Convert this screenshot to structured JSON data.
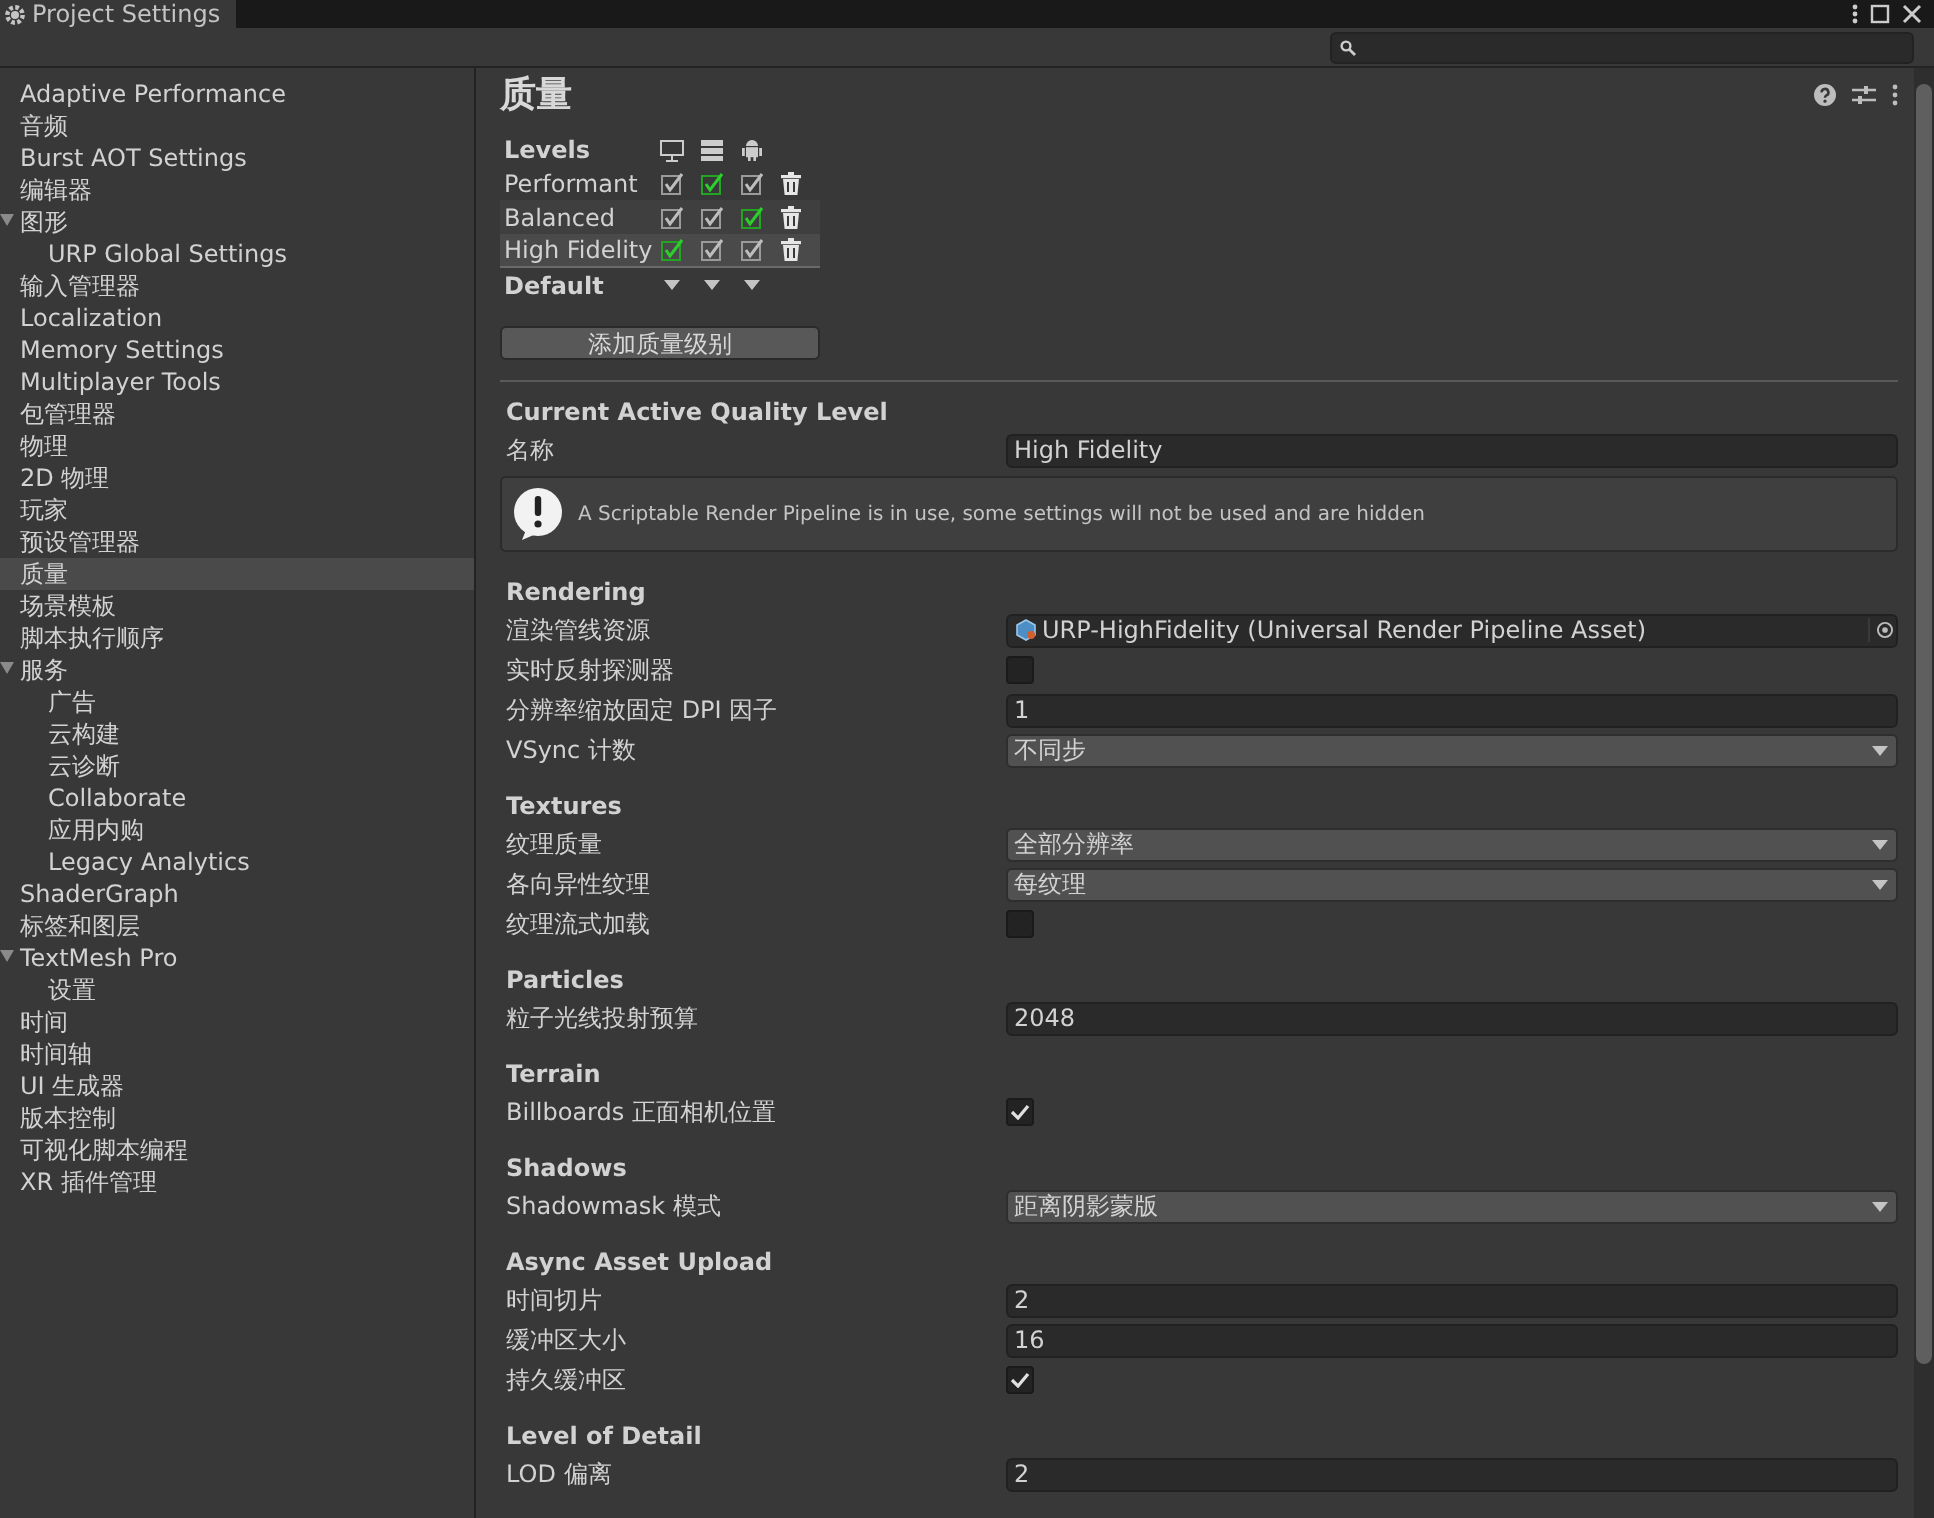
{
  "window": {
    "title": "Project Settings"
  },
  "sidebar": {
    "items": [
      {
        "label": "Adaptive Performance",
        "selected": false
      },
      {
        "label": "音频",
        "selected": false
      },
      {
        "label": "Burst AOT Settings",
        "selected": false
      },
      {
        "label": "编辑器",
        "selected": false
      },
      {
        "label": "图形",
        "selected": false,
        "expanded": true,
        "children": [
          {
            "label": "URP Global Settings",
            "selected": false
          }
        ]
      },
      {
        "label": "输入管理器",
        "selected": false
      },
      {
        "label": "Localization",
        "selected": false
      },
      {
        "label": "Memory Settings",
        "selected": false
      },
      {
        "label": "Multiplayer Tools",
        "selected": false
      },
      {
        "label": "包管理器",
        "selected": false
      },
      {
        "label": "物理",
        "selected": false
      },
      {
        "label": "2D 物理",
        "selected": false
      },
      {
        "label": "玩家",
        "selected": false
      },
      {
        "label": "预设管理器",
        "selected": false
      },
      {
        "label": "质量",
        "selected": true
      },
      {
        "label": "场景模板",
        "selected": false
      },
      {
        "label": "脚本执行顺序",
        "selected": false
      },
      {
        "label": "服务",
        "selected": false,
        "expanded": true,
        "children": [
          {
            "label": "广告",
            "selected": false
          },
          {
            "label": "云构建",
            "selected": false
          },
          {
            "label": "云诊断",
            "selected": false
          },
          {
            "label": "Collaborate",
            "selected": false
          },
          {
            "label": "应用内购",
            "selected": false
          },
          {
            "label": "Legacy Analytics",
            "selected": false
          }
        ]
      },
      {
        "label": "ShaderGraph",
        "selected": false
      },
      {
        "label": "标签和图层",
        "selected": false
      },
      {
        "label": "TextMesh Pro",
        "selected": false,
        "expanded": true,
        "children": [
          {
            "label": "设置",
            "selected": false
          }
        ]
      },
      {
        "label": "时间",
        "selected": false
      },
      {
        "label": "时间轴",
        "selected": false
      },
      {
        "label": "UI 生成器",
        "selected": false
      },
      {
        "label": "版本控制",
        "selected": false
      },
      {
        "label": "可视化脚本编程",
        "selected": false
      },
      {
        "label": "XR 插件管理",
        "selected": false
      }
    ]
  },
  "page": {
    "title": "质量",
    "levels": {
      "label": "Levels",
      "default_label": "Default",
      "add_button": "添加质量级别",
      "rows": [
        {
          "name": "Performant",
          "selected": false,
          "platforms": [
            {
              "checked": true,
              "default": false
            },
            {
              "checked": true,
              "default": true
            },
            {
              "checked": true,
              "default": false
            }
          ]
        },
        {
          "name": "Balanced",
          "selected": false,
          "platforms": [
            {
              "checked": true,
              "default": false
            },
            {
              "checked": true,
              "default": false
            },
            {
              "checked": true,
              "default": true
            }
          ]
        },
        {
          "name": "High Fidelity",
          "selected": true,
          "platforms": [
            {
              "checked": true,
              "default": true
            },
            {
              "checked": true,
              "default": false
            },
            {
              "checked": true,
              "default": false
            }
          ]
        }
      ]
    },
    "sections": [
      {
        "title": "Current Active Quality Level",
        "rows": [
          {
            "kind": "text",
            "label": "名称",
            "value": "High Fidelity"
          }
        ],
        "notice": "A Scriptable Render Pipeline is in use, some settings will not be used and are hidden"
      },
      {
        "title": "Rendering",
        "rows": [
          {
            "kind": "object",
            "label": "渲染管线资源",
            "value": "URP-HighFidelity (Universal Render Pipeline Asset)"
          },
          {
            "kind": "checkbox",
            "label": "实时反射探测器",
            "checked": false
          },
          {
            "kind": "text",
            "label": "分辨率缩放固定 DPI 因子",
            "value": "1"
          },
          {
            "kind": "dropdown",
            "label": "VSync 计数",
            "value": "不同步"
          }
        ]
      },
      {
        "title": "Textures",
        "rows": [
          {
            "kind": "dropdown",
            "label": "纹理质量",
            "value": "全部分辨率"
          },
          {
            "kind": "dropdown",
            "label": "各向异性纹理",
            "value": "每纹理"
          },
          {
            "kind": "checkbox",
            "label": "纹理流式加载",
            "checked": false
          }
        ]
      },
      {
        "title": "Particles",
        "rows": [
          {
            "kind": "text",
            "label": "粒子光线投射预算",
            "value": "2048"
          }
        ]
      },
      {
        "title": "Terrain",
        "rows": [
          {
            "kind": "checkbox",
            "label": "Billboards 正面相机位置",
            "checked": true
          }
        ]
      },
      {
        "title": "Shadows",
        "rows": [
          {
            "kind": "dropdown",
            "label": "Shadowmask 模式",
            "value": "距离阴影蒙版"
          }
        ]
      },
      {
        "title": "Async Asset Upload",
        "rows": [
          {
            "kind": "text",
            "label": "时间切片",
            "value": "2"
          },
          {
            "kind": "text",
            "label": "缓冲区大小",
            "value": "16"
          },
          {
            "kind": "checkbox",
            "label": "持久缓冲区",
            "checked": true
          }
        ]
      },
      {
        "title": "Level of Detail",
        "rows": [
          {
            "kind": "text",
            "label": "LOD 偏离",
            "value": "2"
          }
        ]
      }
    ]
  }
}
